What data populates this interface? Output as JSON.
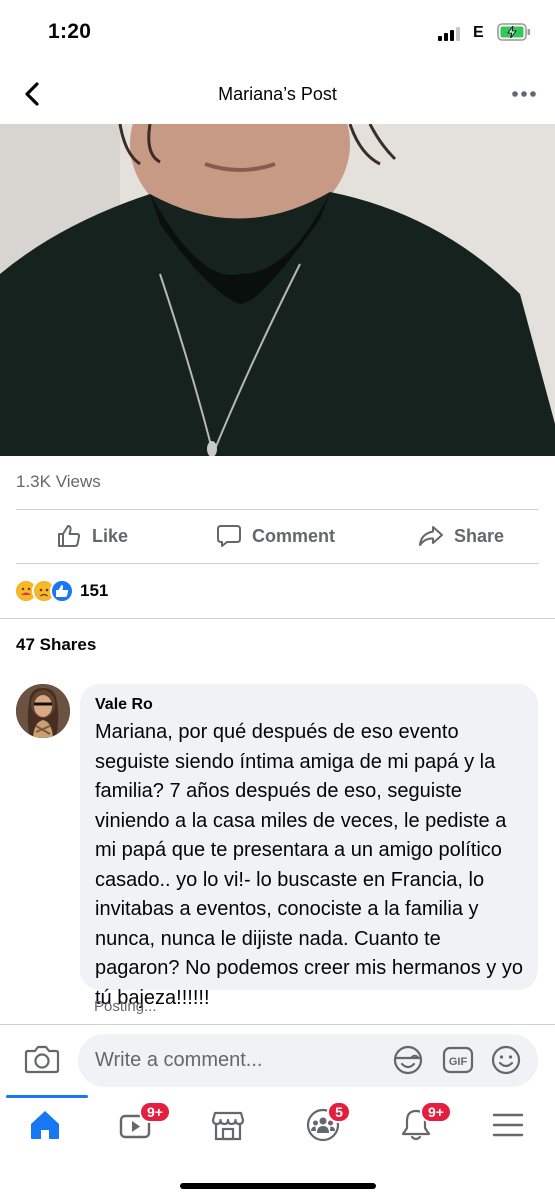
{
  "status_bar": {
    "time": "1:20",
    "network": "E"
  },
  "nav": {
    "title": "Mariana’s Post"
  },
  "post": {
    "views": "1.3K Views",
    "reactions_count": "151",
    "shares": "47 Shares"
  },
  "actions": {
    "like": "Like",
    "comment": "Comment",
    "share": "Share"
  },
  "comment": {
    "author": "Vale Ro",
    "text": "Mariana, por qué después de eso evento seguiste siendo íntima amiga de mi papá y la familia? 7 años después de eso, seguiste viniendo a la casa miles de veces, le pediste a mi papá que te presentara a un amigo político casado.. yo lo vi!- lo buscaste en Francia, lo invitabas a eventos, conociste a la familia y nunca, nunca le dijiste nada. Cuanto te pagaron? No podemos creer mis hermanos y yo tú bajeza!!!!!!",
    "status": "Posting..."
  },
  "composer": {
    "placeholder": "Write a comment..."
  },
  "tabbar": {
    "items": [
      {
        "name": "home",
        "icon": "home-icon",
        "badge": ""
      },
      {
        "name": "watch",
        "icon": "video-icon",
        "badge": "9+"
      },
      {
        "name": "marketplace",
        "icon": "marketplace-icon",
        "badge": ""
      },
      {
        "name": "groups",
        "icon": "groups-icon",
        "badge": "5"
      },
      {
        "name": "notifications",
        "icon": "bell-icon",
        "badge": "9+"
      },
      {
        "name": "menu",
        "icon": "menu-icon",
        "badge": ""
      }
    ]
  },
  "colors": {
    "accent": "#1877f2",
    "badge": "#e41e3f",
    "secondary_text": "#65676b",
    "bubble": "#f0f2f5"
  }
}
